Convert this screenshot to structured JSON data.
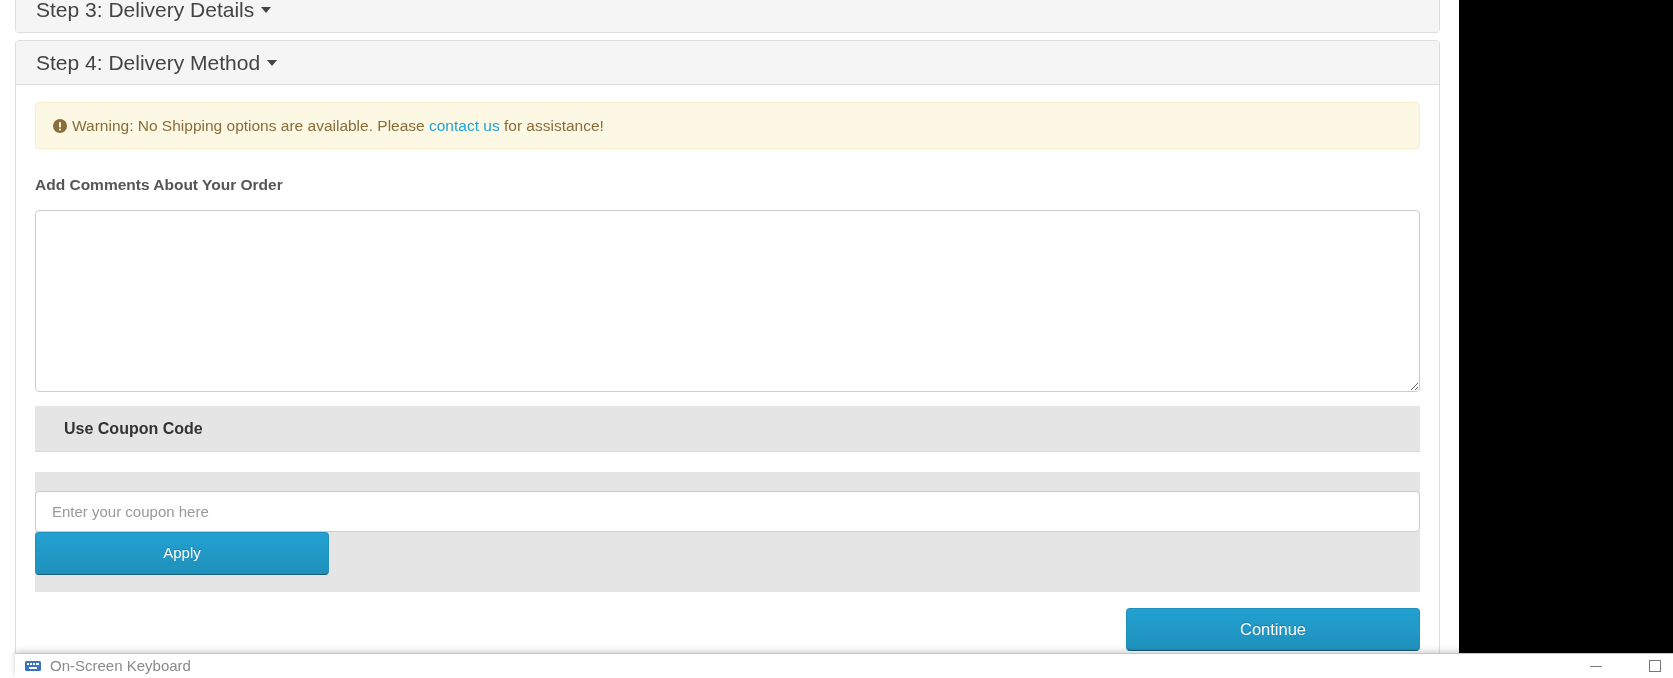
{
  "panels": [
    {
      "title": "Step 3: Delivery Details"
    },
    {
      "title": "Step 4: Delivery Method",
      "alert": {
        "kind": "warning",
        "text": "Warning: No Shipping options are available. Please",
        "link": "contact us",
        "text_after": "for assistance!"
      },
      "comments": {
        "label": "Add Comments About Your Order"
      },
      "coupon": {
        "title": "Use Coupon Code",
        "placeholder": "Enter your coupon here",
        "button": "Apply"
      },
      "button": "Continue"
    }
  ],
  "keyboard_window": {
    "title": "On-Screen Keyboard"
  }
}
